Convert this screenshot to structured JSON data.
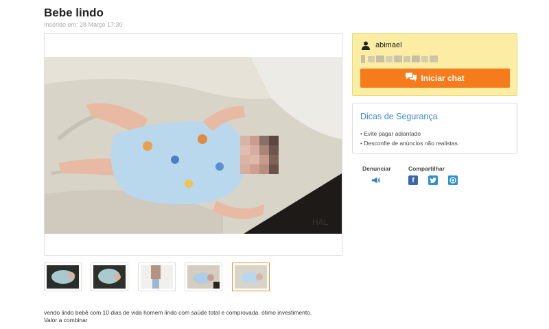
{
  "listing": {
    "title": "Bebe lindo",
    "posted": "Inserido em: 28 Março 17:30",
    "description_line1": "vendo lindo bebê com 10 dias de vida homem lindo com saúde total e comprovada. ótimo investimento.",
    "description_line2": "Valor a combinar"
  },
  "seller": {
    "name": "abimael",
    "chat_label": "Iniciar chat"
  },
  "safety": {
    "title": "Dicas de Segurança",
    "tips": [
      "Evite pagar adiantado",
      "Desconfie de anúncios não realistas"
    ]
  },
  "actions": {
    "report_label": "Denunciar",
    "share_label": "Compartilhar"
  },
  "colors": {
    "accent_orange": "#f57b1c",
    "link_blue": "#3a8cc7",
    "seller_box_bg": "#fbeea4"
  }
}
